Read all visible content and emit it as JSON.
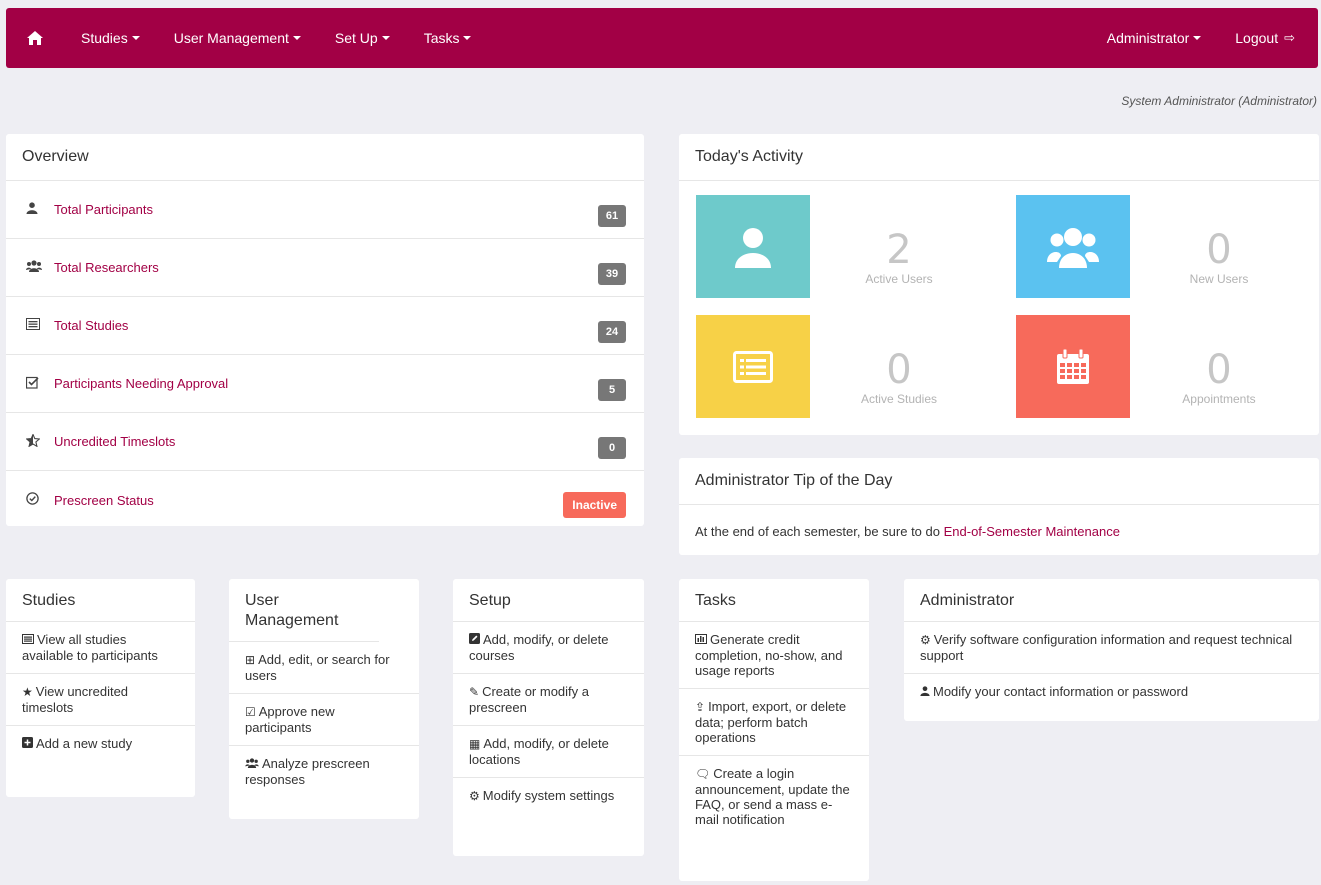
{
  "nav": {
    "items": [
      "Studies",
      "User Management",
      "Set Up",
      "Tasks"
    ],
    "admin_label": "Administrator",
    "logout_label": "Logout"
  },
  "user_line": "System Administrator (Administrator)",
  "overview": {
    "title": "Overview",
    "rows": [
      {
        "label": "Total Participants",
        "value": "61"
      },
      {
        "label": "Total Researchers",
        "value": "39"
      },
      {
        "label": "Total Studies",
        "value": "24"
      },
      {
        "label": "Participants Needing Approval",
        "value": "5"
      },
      {
        "label": "Uncredited Timeslots",
        "value": "0"
      },
      {
        "label": "Prescreen Status",
        "value": "Inactive"
      }
    ]
  },
  "activity": {
    "title": "Today's Activity",
    "stats": [
      {
        "value": "2",
        "label": "Active Users",
        "color": "#6ecacb"
      },
      {
        "value": "0",
        "label": "New Users",
        "color": "#5bc2f0"
      },
      {
        "value": "0",
        "label": "Active Studies",
        "color": "#f7d147"
      },
      {
        "value": "0",
        "label": "Appointments",
        "color": "#f76a5b"
      }
    ]
  },
  "tip": {
    "title": "Administrator Tip of the Day",
    "text": "At the end of each semester, be sure to do ",
    "link": "End-of-Semester Maintenance"
  },
  "studies": {
    "title": "Studies",
    "items": [
      "View all studies available to participants",
      "View uncredited timeslots",
      "Add a new study"
    ]
  },
  "user_management": {
    "title": "User Management",
    "items": [
      "Add, edit, or search for users",
      "Approve new participants",
      "Analyze prescreen responses"
    ]
  },
  "setup": {
    "title": "Setup",
    "items": [
      "Add, modify, or delete courses",
      "Create or modify a prescreen",
      "Add, modify, or delete locations",
      "Modify system settings"
    ]
  },
  "tasks": {
    "title": "Tasks",
    "items": [
      "Generate credit completion, no-show, and usage reports",
      "Import, export, or delete data; perform batch operations",
      "Create a login announcement, update the FAQ, or send a mass e-mail notification"
    ]
  },
  "administrator": {
    "title": "Administrator",
    "items": [
      "Verify software configuration information and request technical support",
      "Modify your contact information or password"
    ]
  },
  "colors": {
    "brand": "#a20045",
    "badge": "#777777",
    "inactive": "#f76a5b"
  }
}
